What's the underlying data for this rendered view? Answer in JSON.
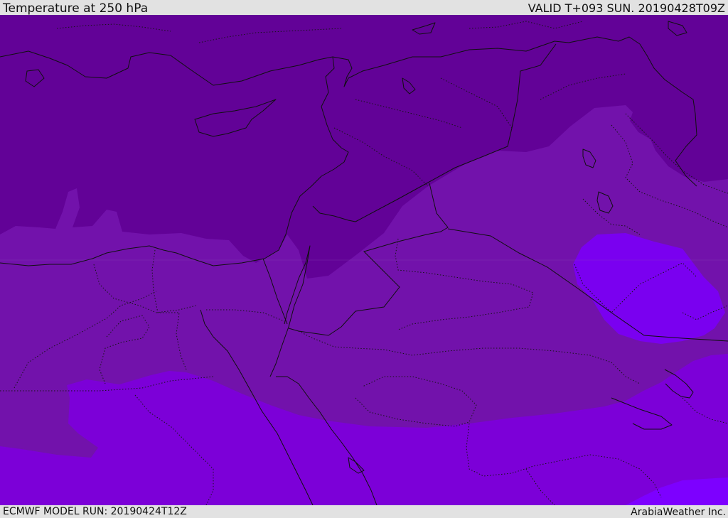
{
  "header": {
    "title": "Temperature at 250 hPa",
    "valid": "VALID T+093 SUN. 20190428T09Z"
  },
  "footer": {
    "model_run": "ECMWF MODEL RUN: 20190424T12Z",
    "credit": "ArabiaWeather Inc."
  },
  "map": {
    "variable": "temperature",
    "level": "250 hPa",
    "colors": {
      "coldest": "#620297",
      "cold": "#7212ab",
      "mid": "#7c00d8",
      "warm": "#7a00f0",
      "warmest": "#7d00ff",
      "lines": "#101010"
    }
  }
}
